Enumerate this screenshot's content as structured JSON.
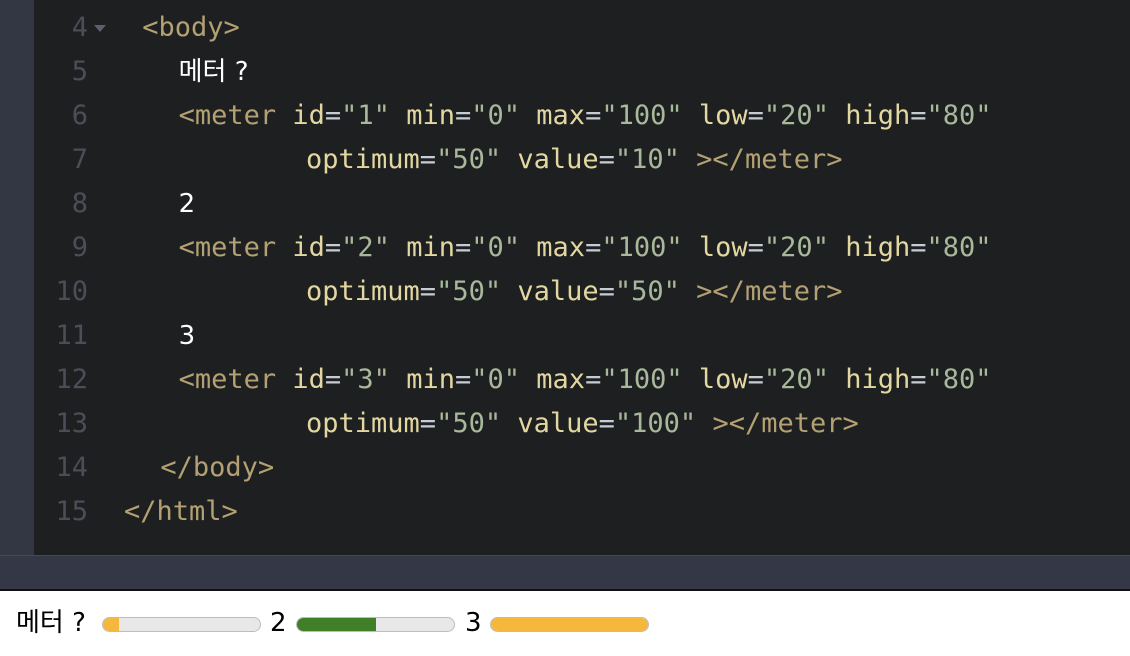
{
  "editor": {
    "lines": [
      {
        "num": "4",
        "fold": true,
        "indent": 1,
        "tokens": [
          {
            "t": "tag",
            "v": "<body>"
          }
        ]
      },
      {
        "num": "5",
        "indent": 3,
        "tokens": [
          {
            "t": "txt",
            "v": "메터 ?"
          }
        ]
      },
      {
        "num": "6",
        "indent": 3,
        "tokens": [
          {
            "t": "tag",
            "v": "<meter "
          },
          {
            "t": "attr",
            "v": "id"
          },
          {
            "t": "eq",
            "v": "="
          },
          {
            "t": "str",
            "v": "\"1\" "
          },
          {
            "t": "attr",
            "v": "min"
          },
          {
            "t": "eq",
            "v": "="
          },
          {
            "t": "str",
            "v": "\"0\" "
          },
          {
            "t": "attr",
            "v": "max"
          },
          {
            "t": "eq",
            "v": "="
          },
          {
            "t": "str",
            "v": "\"100\" "
          },
          {
            "t": "attr",
            "v": "low"
          },
          {
            "t": "eq",
            "v": "="
          },
          {
            "t": "str",
            "v": "\"20\" "
          },
          {
            "t": "attr",
            "v": "high"
          },
          {
            "t": "eq",
            "v": "="
          },
          {
            "t": "str",
            "v": "\"80\""
          }
        ]
      },
      {
        "num": "7",
        "indent": 10,
        "tokens": [
          {
            "t": "attr",
            "v": "optimum"
          },
          {
            "t": "eq",
            "v": "="
          },
          {
            "t": "str",
            "v": "\"50\" "
          },
          {
            "t": "attr",
            "v": "value"
          },
          {
            "t": "eq",
            "v": "="
          },
          {
            "t": "str",
            "v": "\"10\" "
          },
          {
            "t": "tag",
            "v": "></meter>"
          }
        ]
      },
      {
        "num": "8",
        "indent": 3,
        "tokens": [
          {
            "t": "txt",
            "v": "2"
          }
        ]
      },
      {
        "num": "9",
        "indent": 3,
        "tokens": [
          {
            "t": "tag",
            "v": "<meter "
          },
          {
            "t": "attr",
            "v": "id"
          },
          {
            "t": "eq",
            "v": "="
          },
          {
            "t": "str",
            "v": "\"2\" "
          },
          {
            "t": "attr",
            "v": "min"
          },
          {
            "t": "eq",
            "v": "="
          },
          {
            "t": "str",
            "v": "\"0\" "
          },
          {
            "t": "attr",
            "v": "max"
          },
          {
            "t": "eq",
            "v": "="
          },
          {
            "t": "str",
            "v": "\"100\" "
          },
          {
            "t": "attr",
            "v": "low"
          },
          {
            "t": "eq",
            "v": "="
          },
          {
            "t": "str",
            "v": "\"20\" "
          },
          {
            "t": "attr",
            "v": "high"
          },
          {
            "t": "eq",
            "v": "="
          },
          {
            "t": "str",
            "v": "\"80\""
          }
        ]
      },
      {
        "num": "10",
        "indent": 10,
        "tokens": [
          {
            "t": "attr",
            "v": "optimum"
          },
          {
            "t": "eq",
            "v": "="
          },
          {
            "t": "str",
            "v": "\"50\" "
          },
          {
            "t": "attr",
            "v": "value"
          },
          {
            "t": "eq",
            "v": "="
          },
          {
            "t": "str",
            "v": "\"50\" "
          },
          {
            "t": "tag",
            "v": "></meter>"
          }
        ]
      },
      {
        "num": "11",
        "indent": 3,
        "tokens": [
          {
            "t": "txt",
            "v": "3"
          }
        ]
      },
      {
        "num": "12",
        "indent": 3,
        "tokens": [
          {
            "t": "tag",
            "v": "<meter "
          },
          {
            "t": "attr",
            "v": "id"
          },
          {
            "t": "eq",
            "v": "="
          },
          {
            "t": "str",
            "v": "\"3\" "
          },
          {
            "t": "attr",
            "v": "min"
          },
          {
            "t": "eq",
            "v": "="
          },
          {
            "t": "str",
            "v": "\"0\" "
          },
          {
            "t": "attr",
            "v": "max"
          },
          {
            "t": "eq",
            "v": "="
          },
          {
            "t": "str",
            "v": "\"100\" "
          },
          {
            "t": "attr",
            "v": "low"
          },
          {
            "t": "eq",
            "v": "="
          },
          {
            "t": "str",
            "v": "\"20\" "
          },
          {
            "t": "attr",
            "v": "high"
          },
          {
            "t": "eq",
            "v": "="
          },
          {
            "t": "str",
            "v": "\"80\""
          }
        ]
      },
      {
        "num": "13",
        "indent": 10,
        "tokens": [
          {
            "t": "attr",
            "v": "optimum"
          },
          {
            "t": "eq",
            "v": "="
          },
          {
            "t": "str",
            "v": "\"50\" "
          },
          {
            "t": "attr",
            "v": "value"
          },
          {
            "t": "eq",
            "v": "="
          },
          {
            "t": "str",
            "v": "\"100\" "
          },
          {
            "t": "tag",
            "v": "></meter>"
          }
        ]
      },
      {
        "num": "14",
        "indent": 2,
        "tokens": [
          {
            "t": "tag",
            "v": "</body>"
          }
        ]
      },
      {
        "num": "15",
        "indent": 0,
        "tokens": [
          {
            "t": "tag",
            "v": "</html>"
          }
        ]
      }
    ]
  },
  "preview": {
    "label_1": "메터 ?",
    "label_2": "2",
    "label_3": "3",
    "meters": [
      {
        "value": 10,
        "min": 0,
        "max": 100,
        "color": "#f5b83d"
      },
      {
        "value": 50,
        "min": 0,
        "max": 100,
        "color": "#3f7f28"
      },
      {
        "value": 100,
        "min": 0,
        "max": 100,
        "color": "#f5b83d"
      }
    ]
  }
}
